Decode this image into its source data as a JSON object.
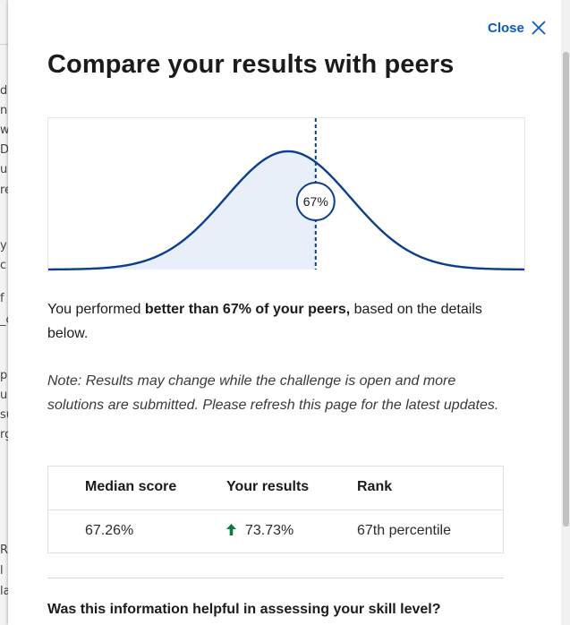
{
  "background_fragments": [
    "d",
    "n",
    "w",
    "D",
    "u",
    "re",
    "y",
    "c",
    "f",
    "_c",
    "p",
    "u",
    "su",
    "rg",
    "R",
    "l",
    "la"
  ],
  "modal": {
    "close_label": "Close",
    "title": "Compare your results with peers",
    "summary": {
      "prefix": "You performed ",
      "emphasis": "better than 67% of your peers,",
      "suffix": " based on the details below."
    },
    "note": "Note: Results may change while the challenge is open and more solutions are submitted. Please refresh this page for the latest updates.",
    "table": {
      "headers": [
        "Median score",
        "Your results",
        "Rank"
      ],
      "values": {
        "median_score": "67.26%",
        "your_results": "73.73%",
        "rank": "67th percentile"
      }
    },
    "feedback_question": "Was this information helpful in assessing your skill level?"
  },
  "chart_data": {
    "type": "area",
    "marker_label": "67%",
    "marker_percentile": 67,
    "colors": {
      "curve": "#0b3d91",
      "fill": "#e8eff9",
      "marker": "#0b3d91"
    }
  },
  "colors": {
    "link": "#0a5ac2",
    "arrow_up": "#0e7a3d"
  },
  "icons": {
    "close": "close-x-icon",
    "results_trend": "arrow-up-icon"
  }
}
